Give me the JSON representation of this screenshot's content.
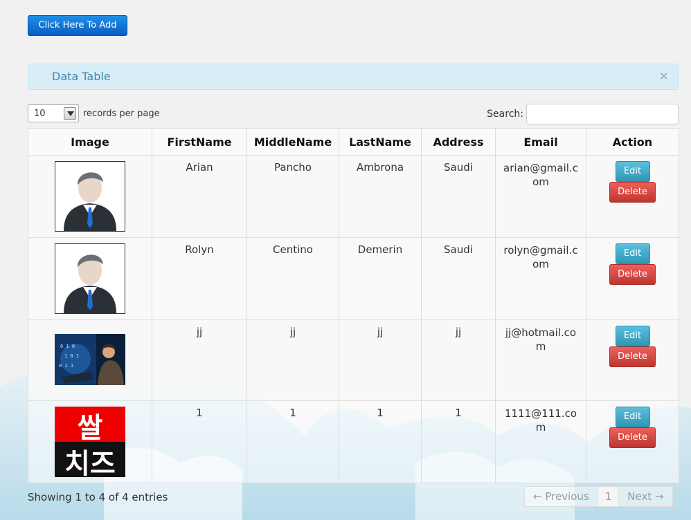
{
  "toolbar": {
    "add_label": "Click Here To Add"
  },
  "panel": {
    "title": "Data Table",
    "close": "×"
  },
  "length": {
    "value": "10",
    "label": "records per page"
  },
  "search": {
    "label": "Search:",
    "placeholder": ""
  },
  "table": {
    "headers": [
      "Image",
      "FirstName",
      "MiddleName",
      "LastName",
      "Address",
      "Email",
      "Action"
    ],
    "rows": [
      {
        "first": "Arian",
        "middle": "Pancho",
        "last": "Ambrona",
        "address": "Saudi",
        "email": "arian@gmail.com",
        "image": "avatar-icon"
      },
      {
        "first": "Rolyn",
        "middle": "Centino",
        "last": "Demerin",
        "address": "Saudi",
        "email": "rolyn@gmail.com",
        "image": "avatar-icon"
      },
      {
        "first": "jj",
        "middle": "jj",
        "last": "jj",
        "address": "jj",
        "email": "jj@hotmail.com",
        "image": "hacker-photo"
      },
      {
        "first": "1",
        "middle": "1",
        "last": "1",
        "address": "1",
        "email": "1111@111.com",
        "image": "korean-text-logo"
      }
    ],
    "edit_label": "Edit",
    "delete_label": "Delete"
  },
  "footer": {
    "info": "Showing 1 to 4 of 4 entries",
    "prev": "← Previous",
    "page": "1",
    "next": "Next →"
  },
  "logo_text": {
    "top": "쌀",
    "bottom": "치즈"
  },
  "colors": {
    "primary": "#0b5fc4",
    "info": "#5bc0de",
    "danger": "#da4f49",
    "alert_bg": "#d9edf7",
    "alert_text": "#3a87ad",
    "logo_red": "#ee0000"
  }
}
